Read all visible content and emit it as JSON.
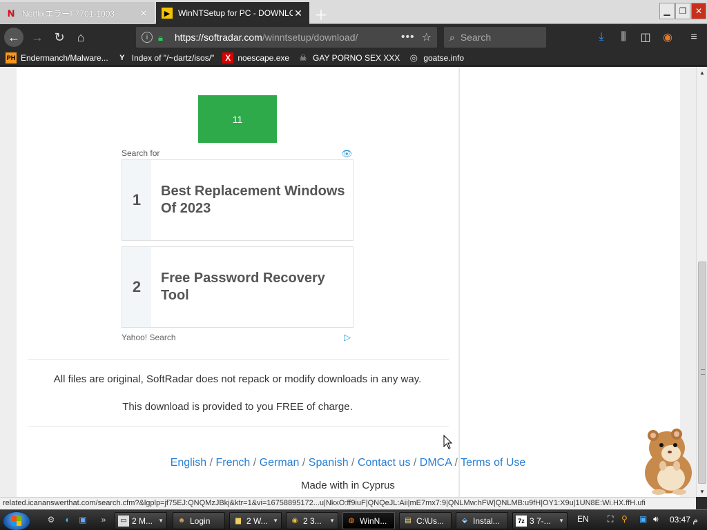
{
  "tabs": [
    {
      "label": "NetflixエラーF7701-1003",
      "favicon": "netflix-icon",
      "active": false
    },
    {
      "label": "WinNTSetup for PC - DOWNLOAD",
      "favicon": "softradar-icon",
      "active": true
    }
  ],
  "address": {
    "host": "https://softradar.com",
    "path": "/winntsetup/download/"
  },
  "search": {
    "placeholder": "Search"
  },
  "bookmarks": [
    {
      "label": "Endermanch/Malware...",
      "icon": "ph-icon"
    },
    {
      "label": "Index of \"/~dartz/isos/\"",
      "icon": "yc-icon"
    },
    {
      "label": "noescape.exe",
      "icon": "x-icon"
    },
    {
      "label": "GAY PORNO SEX XXX",
      "icon": "skull-icon"
    },
    {
      "label": "goatse.info",
      "icon": "globe-icon"
    }
  ],
  "page": {
    "green_box_text": "11",
    "search_for_label": "Search for",
    "ads": [
      {
        "number": "1",
        "text": "Best Replacement Windows Of 2023"
      },
      {
        "number": "2",
        "text": "Free Password Recovery Tool"
      }
    ],
    "yahoo_label": "Yahoo! Search",
    "note_original": "All files are original, SoftRadar does not repack or modify downloads in any way.",
    "note_free": "This download is provided to you FREE of charge.",
    "footer_links": [
      "English",
      "French",
      "German",
      "Spanish",
      "Contact us",
      "DMCA",
      "Terms of Use"
    ],
    "made_with": "Made with in Cyprus"
  },
  "status_text": "related.icananswerthat.com/search.cfm?&lgplp=jf75EJ:QNQMzJBkj&ktr=1&vi=16758895172...u|NkxO:ff9iuF|QNQeJL:Aii|mE7mx7:9|QNLMw:hFW|QNLMB:u9fH|OY1:X9u|1UN8E:Wi.HX.ffH.ufi",
  "taskbar": {
    "items": [
      {
        "label": "2 M...",
        "icon": "window-icon",
        "has_arrow": true
      },
      {
        "label": "Login",
        "icon": "user-icon",
        "has_arrow": false
      },
      {
        "label": "2 W...",
        "icon": "folder-icon",
        "has_arrow": true
      },
      {
        "label": "2 3...",
        "icon": "chrome-icon",
        "has_arrow": true
      },
      {
        "label": "WinN...",
        "icon": "firefox-icon",
        "has_arrow": false,
        "active": true
      },
      {
        "label": "C:\\Us...",
        "icon": "notepad-icon",
        "has_arrow": false
      },
      {
        "label": "Instal...",
        "icon": "installer-icon",
        "has_arrow": false
      },
      {
        "label": "3 7-...",
        "icon": "7zip-icon",
        "has_arrow": true
      }
    ],
    "lang": "EN",
    "clock": "03:47 م"
  },
  "colors": {
    "accent_green": "#2eaa4b",
    "link_blue": "#2a7fd4",
    "firefox_dark": "#2b2b2b"
  }
}
